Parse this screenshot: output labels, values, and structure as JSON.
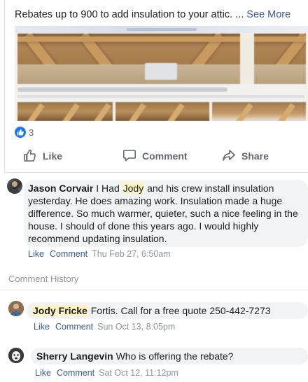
{
  "post": {
    "text": "Rebates up to 900 to add insulation to your attic. ...",
    "see_more": "See More",
    "reaction_count": "3",
    "actions": {
      "like": "Like",
      "comment": "Comment",
      "share": "Share"
    }
  },
  "comments": [
    {
      "author": "Jason Corvair",
      "text_before": " I Had ",
      "mention": "Jody",
      "text_after": " and his crew install insulation yesterday. He does amazing work. Insulation made a huge difference. So much warmer, quieter, such a nice feeling in the house. I should of done this years ago. I would highly recommend updating insulation.",
      "like": "Like",
      "reply": "Comment",
      "timestamp": "Thu Feb 27, 6:50am"
    }
  ],
  "comment_history_label": "Comment History",
  "history": [
    {
      "author": "Jody Fricke",
      "text": " Fortis. Call for a free quote 250-442-7273",
      "like": "Like",
      "reply": "Comment",
      "timestamp": "Sun Oct 13, 8:05pm"
    },
    {
      "author": "Sherry Langevin",
      "text": " Who is offering the rebate?",
      "like": "Like",
      "reply": "Comment",
      "timestamp": "Sat Oct 12, 11:12pm"
    }
  ],
  "colors": {
    "link": "#385898",
    "accent": "#1877f2",
    "bubble": "#f2f3f5",
    "mention_highlight": "#fcf2c4"
  }
}
